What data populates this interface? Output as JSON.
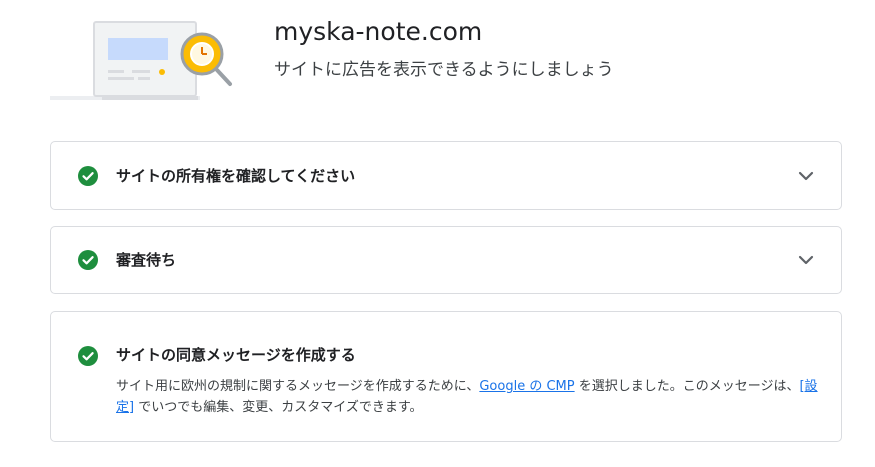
{
  "header": {
    "site_name": "myska-note.com",
    "subtitle": "サイトに広告を表示できるようにしましょう",
    "illustration_icon": "monitor-with-clock-magnifier"
  },
  "steps": [
    {
      "title": "サイトの所有権を確認してください",
      "status": "complete",
      "icon": "check-circle-icon",
      "expandable": true
    },
    {
      "title": "審査待ち",
      "status": "complete",
      "icon": "check-circle-icon",
      "expandable": true
    },
    {
      "title": "サイトの同意メッセージを作成する",
      "status": "complete",
      "icon": "check-circle-icon",
      "expandable": false,
      "desc_part1": "サイト用に欧州の規制に関するメッセージを作成するために、",
      "desc_link1": "Google の CMP",
      "desc_part2": " を選択しました。このメッセージは、",
      "desc_link2": "[設定]",
      "desc_part3": " でいつでも編集、変更、カスタマイズできます。"
    }
  ],
  "colors": {
    "check_green": "#1e8e3e",
    "link_blue": "#1a73e8",
    "border": "#dadce0",
    "clock_yellow": "#fbbc04"
  }
}
